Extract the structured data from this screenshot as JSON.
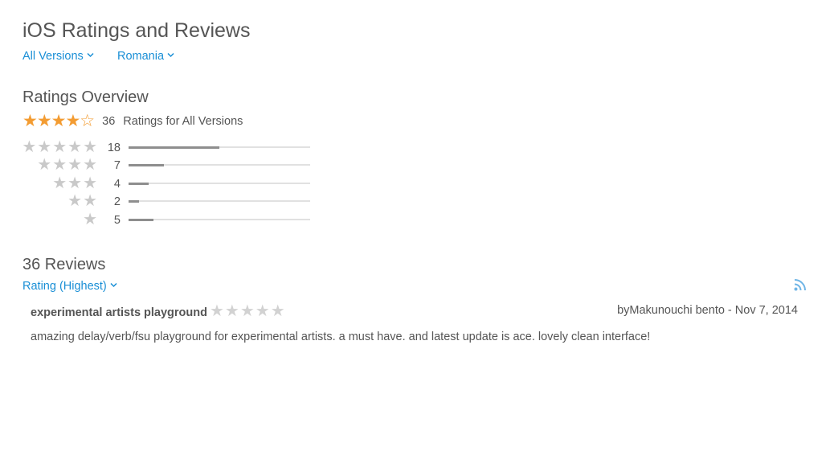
{
  "header": {
    "title": "iOS Ratings and Reviews",
    "version_filter": "All Versions",
    "country_filter": "Romania"
  },
  "overview": {
    "heading": "Ratings Overview",
    "average_stars": 4,
    "average_stars_text": "★★★★☆",
    "total_count": "36",
    "total_label": "Ratings for All Versions",
    "histogram": [
      {
        "stars": 5,
        "stars_text": "★★★★★",
        "count": "18",
        "fraction": 0.5
      },
      {
        "stars": 4,
        "stars_text": "★★★★",
        "count": "7",
        "fraction": 0.194
      },
      {
        "stars": 3,
        "stars_text": "★★★",
        "count": "4",
        "fraction": 0.111
      },
      {
        "stars": 2,
        "stars_text": "★★",
        "count": "2",
        "fraction": 0.056
      },
      {
        "stars": 1,
        "stars_text": "★",
        "count": "5",
        "fraction": 0.139
      }
    ]
  },
  "reviews": {
    "heading": "36 Reviews",
    "sort_label": "Rating (Highest)",
    "items": [
      {
        "title": "experimental artists playground",
        "rating": 0,
        "stars_text": "★★★★★",
        "author_line": "byMakunouchi bento - Nov 7, 2014",
        "body": "amazing delay/verb/fsu playground for experimental artists. a must have. and latest update is ace. lovely clean interface!"
      }
    ]
  },
  "colors": {
    "accent": "#1a8fd6",
    "star_active": "#f39c32",
    "star_inactive": "#c9c9c9",
    "bar_fill": "#8e8e8e",
    "bar_track": "#e1e1e1"
  },
  "icons": {
    "filter_chevron": "chevron-down-icon",
    "feed": "rss-feed-icon"
  }
}
